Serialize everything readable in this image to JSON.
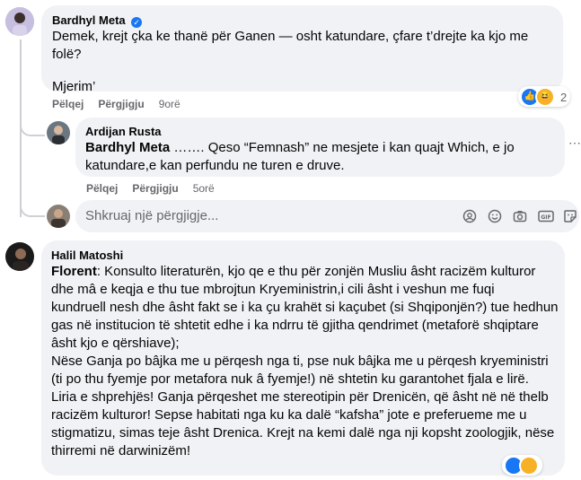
{
  "comment1": {
    "author": "Bardhyl Meta",
    "lines": [
      "Demek, krejt çka ke thanë për Ganen — osht katundare, çfare t’drejte ka kjo me",
      "folë?"
    ],
    "line2": "Mjerim’",
    "actions": {
      "like": "Pëlqej",
      "reply": "Përgjigju",
      "time": "9orë"
    },
    "reaction_count": "2"
  },
  "reply1": {
    "author": "Ardijan Rusta",
    "mention": "Bardhyl Meta",
    "line1_rest": " ……. Qeso “Femnash” ne mesjete i kan quajt Which, e jo",
    "line2": "katundare,e kan perfundu ne turen e druve.",
    "actions": {
      "like": "Pëlqej",
      "reply": "Përgjigju",
      "time": "5orë"
    }
  },
  "reply_input": {
    "placeholder": "Shkruaj një përgjigje..."
  },
  "comment2": {
    "author": "Halil Matoshi",
    "mention": "Florent",
    "first_rest": ": Konsulto literaturën, kjo qe e thu për zonjën Musliu âsht racizëm kulturor",
    "lines": [
      "dhe mâ e keqja e thu tue mbrojtun Kryeministrin,i cili âsht i veshun me fuqi",
      "kundruell nesh dhe âsht fakt se i ka çu krahët si kaçubet (si Shqiponjën?) tue hedhun",
      "gas në institucion të shtetit edhe i ka ndrru të gjitha qendrimet (metaforë shqiptare",
      "âsht kjo e qërshiave);",
      "Nëse Ganja po bâjka me u përqesh nga ti, pse nuk bâjka me u përqesh kryeministri",
      "(ti po thu fyemje por metafora nuk â fyemje!) në shtetin ku garantohet fjala e lirë.",
      "Liria e shprehjës! Ganja përqeshet me stereotipin për Drenicën, që âsht në në thelb",
      "racizëm kulturor! Sepse habitati nga ku ka dalë “kafsha” jote e preferueme me u",
      "stigmatizu, simas teje âsht Drenica. Krejt na kemi dalë nga nji kopsht zoologjik, nëse",
      "thirremi në darwinizëm!"
    ]
  },
  "colors": {
    "bubble": "#f0f2f5",
    "meta": "#65676b",
    "verified": "#1877f2",
    "like": "#1877f2",
    "haha": "#f7b125"
  },
  "icons": [
    "verified-badge-icon",
    "more-icon",
    "sticker-icon",
    "emoji-icon",
    "camera-icon",
    "gif-icon",
    "avatar-sticker-icon",
    "like-reaction-icon",
    "haha-reaction-icon"
  ]
}
